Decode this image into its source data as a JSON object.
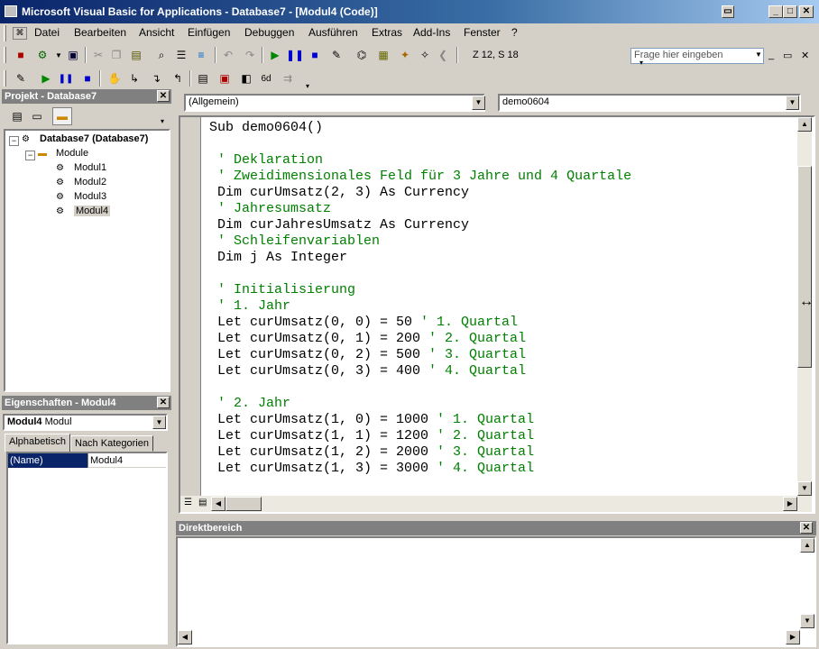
{
  "window": {
    "title": "Microsoft Visual Basic for Applications - Database7 - [Modul4 (Code)]",
    "minimize": "_",
    "maximize": "□",
    "close": "✕"
  },
  "menu": {
    "items": [
      "Datei",
      "Bearbeiten",
      "Ansicht",
      "Einfügen",
      "Debuggen",
      "Ausführen",
      "Extras",
      "Add-Ins",
      "Fenster",
      "?"
    ],
    "help_placeholder": "Frage hier eingeben"
  },
  "toolbar": {
    "position": "Z 12, S 18"
  },
  "project": {
    "title": "Projekt - Database7",
    "root": "Database7 (Database7)",
    "folder": "Module",
    "modules": [
      "Modul1",
      "Modul2",
      "Modul3",
      "Modul4"
    ]
  },
  "properties": {
    "title": "Eigenschaften - Modul4",
    "object": "Modul4",
    "object_type": "Modul",
    "tab_alpha": "Alphabetisch",
    "tab_category": "Nach Kategorien",
    "rows": [
      {
        "name": "(Name)",
        "value": "Modul4"
      }
    ]
  },
  "editor": {
    "object_combo": "(Allgemein)",
    "proc_combo": "demo0604",
    "lines": [
      {
        "text": "Sub demo0604()",
        "type": "code"
      },
      {
        "text": "",
        "type": "code"
      },
      {
        "text": " ' Deklaration",
        "type": "comment"
      },
      {
        "text": " ' Zweidimensionales Feld für 3 Jahre und 4 Quartale",
        "type": "comment"
      },
      {
        "text": " Dim curUmsatz(2, 3) As Currency",
        "type": "code"
      },
      {
        "text": " ' Jahresumsatz",
        "type": "comment"
      },
      {
        "text": " Dim curJahresUmsatz As Currency",
        "type": "code"
      },
      {
        "text": " ' Schleifenvariablen",
        "type": "comment"
      },
      {
        "text": " Dim j As Integer",
        "type": "code"
      },
      {
        "text": "",
        "type": "code"
      },
      {
        "text": " ' Initialisierung",
        "type": "comment"
      },
      {
        "text": " ' 1. Jahr",
        "type": "comment"
      },
      {
        "text": " Let curUmsatz(0, 0) = 50 ",
        "type": "code",
        "comment": "' 1. Quartal"
      },
      {
        "text": " Let curUmsatz(0, 1) = 200 ",
        "type": "code",
        "comment": "' 2. Quartal"
      },
      {
        "text": " Let curUmsatz(0, 2) = 500 ",
        "type": "code",
        "comment": "' 3. Quartal"
      },
      {
        "text": " Let curUmsatz(0, 3) = 400 ",
        "type": "code",
        "comment": "' 4. Quartal"
      },
      {
        "text": "",
        "type": "code"
      },
      {
        "text": " ' 2. Jahr",
        "type": "comment"
      },
      {
        "text": " Let curUmsatz(1, 0) = 1000 ",
        "type": "code",
        "comment": "' 1. Quartal"
      },
      {
        "text": " Let curUmsatz(1, 1) = 1200 ",
        "type": "code",
        "comment": "' 2. Quartal"
      },
      {
        "text": " Let curUmsatz(1, 2) = 2000 ",
        "type": "code",
        "comment": "' 3. Quartal"
      },
      {
        "text": " Let curUmsatz(1, 3) = 3000 ",
        "type": "code",
        "comment": "' 4. Quartal"
      }
    ]
  },
  "immediate": {
    "title": "Direktbereich"
  }
}
